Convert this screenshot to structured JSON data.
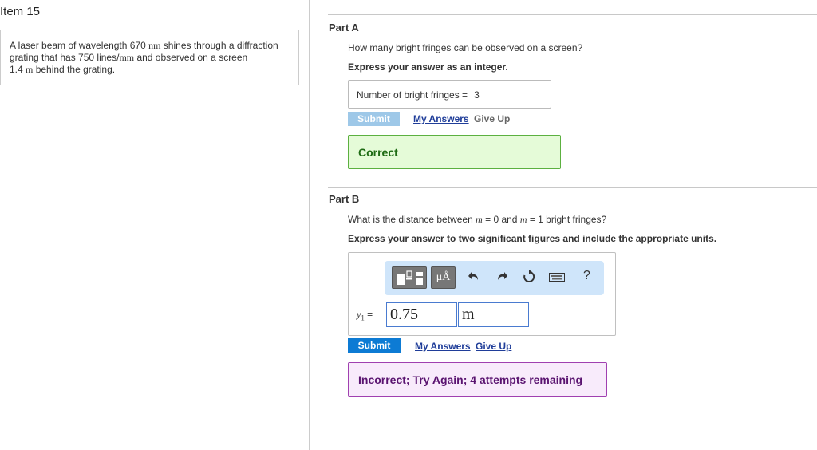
{
  "item_title": "Item 15",
  "problem": {
    "t1": "A laser beam of wavelength 670 ",
    "u1": "nm",
    "t2": " shines through a diffraction",
    "t3": "grating that has 750 lines/",
    "u2": "mm",
    "t4": " and observed on a screen",
    "t5": "1.4 ",
    "u3": "m",
    "t6": " behind the grating."
  },
  "partA": {
    "title": "Part A",
    "question": "How many bright fringes can be observed on a screen?",
    "instruction": "Express your answer as an integer.",
    "answer_label": "Number of bright fringes =",
    "answer_value": "3",
    "submit_label": "Submit",
    "my_answers_label": "My Answers",
    "give_up_label": "Give Up",
    "feedback": "Correct"
  },
  "partB": {
    "title": "Part B",
    "q1": "What is the distance between ",
    "m_sym": "m",
    "q2": " = 0 and ",
    "q3": " = 1 bright fringes?",
    "instruction": "Express your answer to two significant figures and include the appropriate units.",
    "toolbar": {
      "units_label": "μÅ",
      "help_label": "?"
    },
    "var_name": "y",
    "var_sub": "1",
    "equals": " =",
    "value": "0.75",
    "unit": "m",
    "submit_label": "Submit",
    "my_answers_label": "My Answers",
    "give_up_label": "Give Up",
    "feedback": "Incorrect; Try Again; 4 attempts remaining"
  },
  "colors": {
    "correct_bg": "#e5fbd8",
    "incorrect_bg": "#f8ebfb",
    "submit_active": "#0d7bd4",
    "submit_disabled": "#9ec8e8",
    "toolbar_bg": "#cfe5fa"
  },
  "icons": [
    "templates-icon",
    "units-icon",
    "undo-icon",
    "redo-icon",
    "reset-icon",
    "keyboard-icon",
    "help-icon"
  ]
}
